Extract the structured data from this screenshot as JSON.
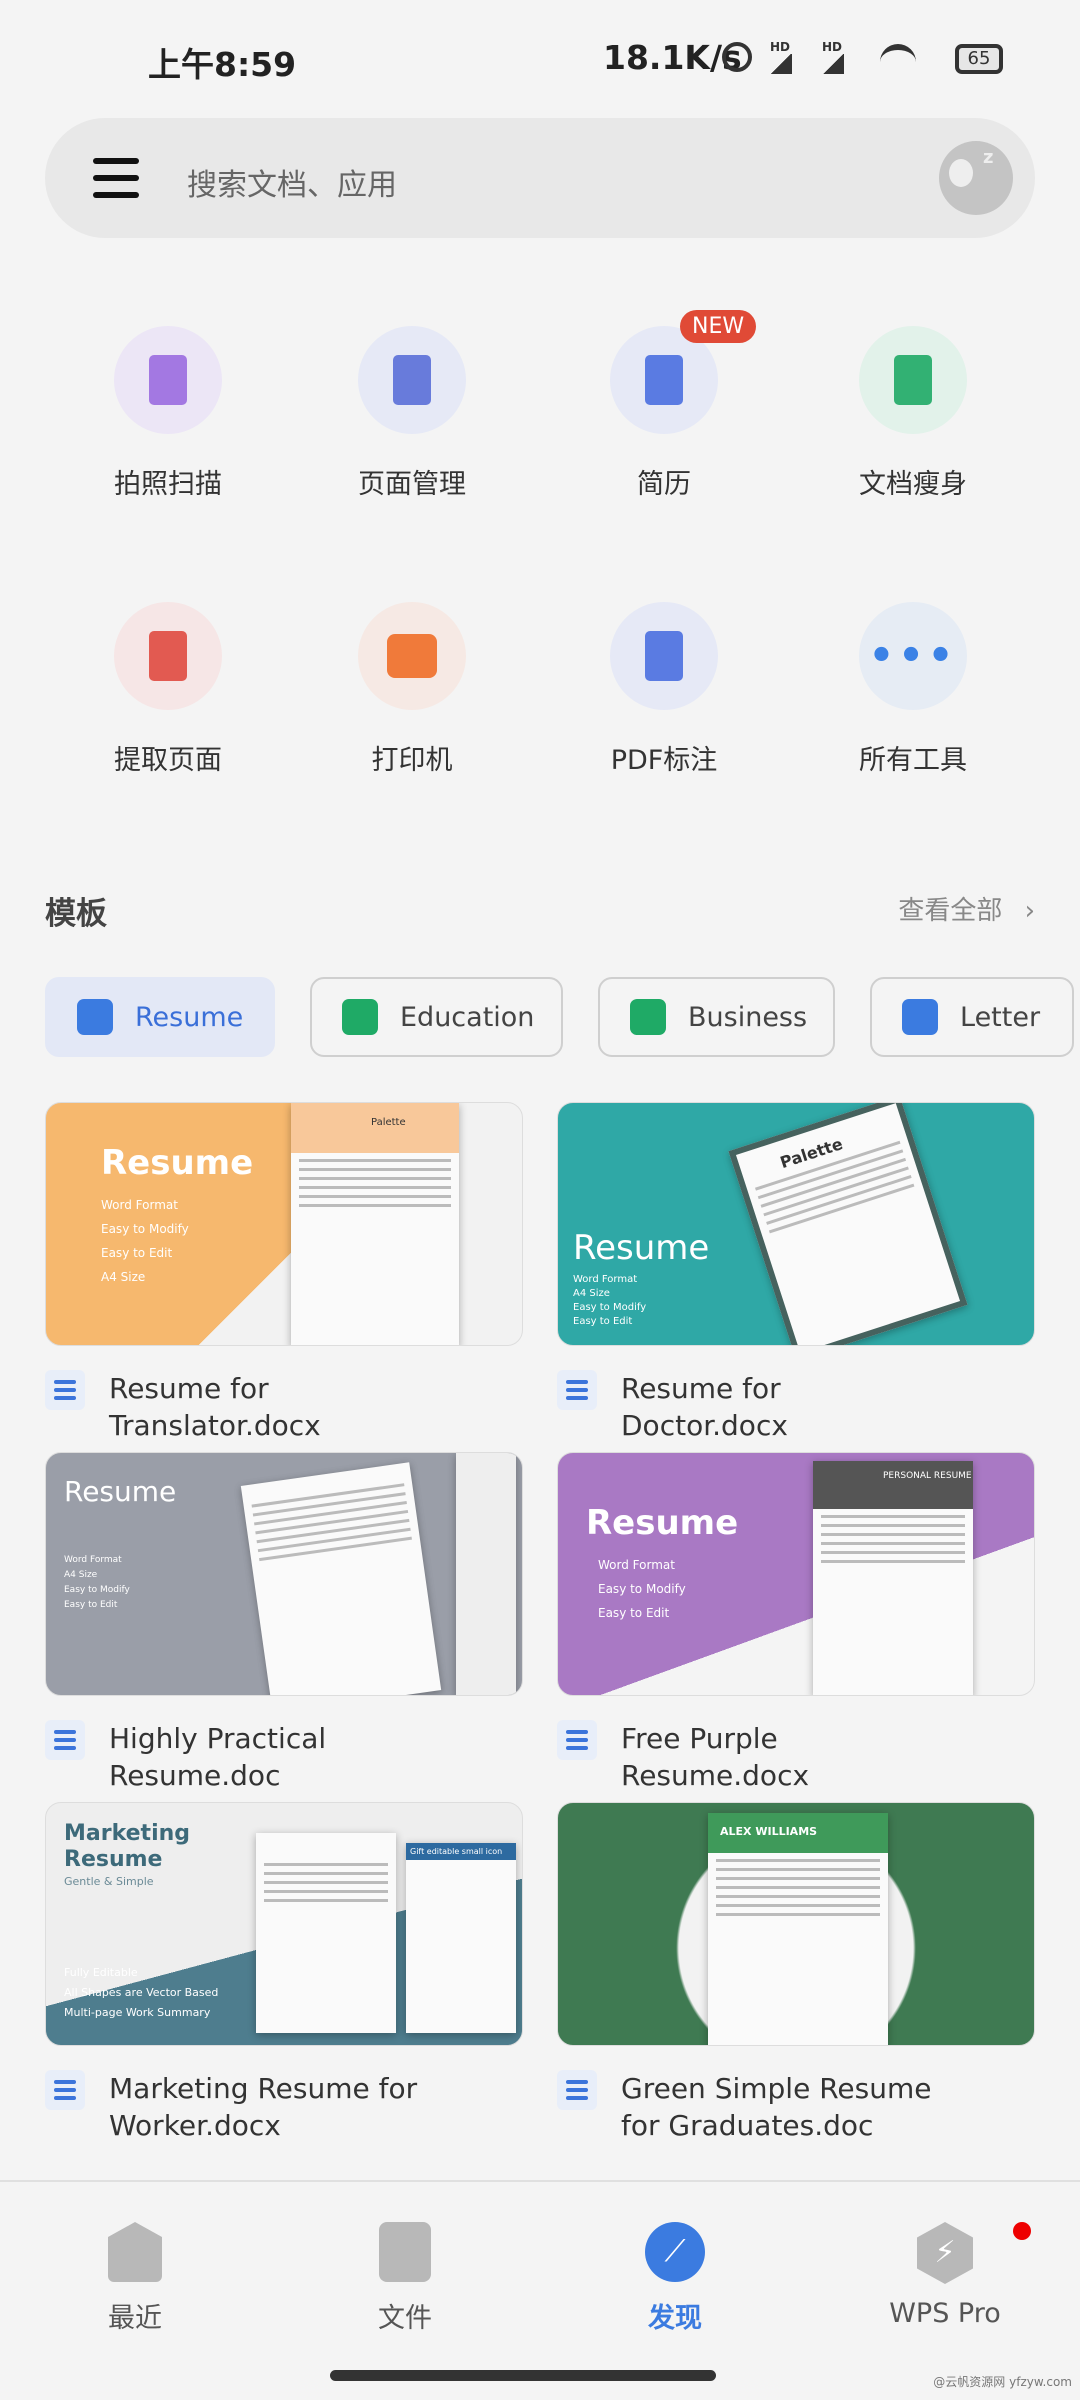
{
  "status_bar": {
    "time": "上午8:59",
    "speed": "18.1K/s",
    "hd1": "HD",
    "hd2": "HD",
    "battery": "65"
  },
  "search": {
    "placeholder": "搜索文档、应用",
    "menu_icon": "hamburger-icon",
    "avatar_icon": "sleeping-avatar-icon"
  },
  "tools": [
    {
      "label": "拍照扫描",
      "icon": "scan-icon",
      "color": "#9b6be0",
      "bg": "#ece6f6"
    },
    {
      "label": "页面管理",
      "icon": "page-manage-icon",
      "color": "#5a6fd8",
      "bg": "#e6e9f6"
    },
    {
      "label": "简历",
      "icon": "resume-icon",
      "color": "#4a6fe0",
      "bg": "#e6e9f6",
      "badge": "NEW"
    },
    {
      "label": "文档瘦身",
      "icon": "doc-slim-icon",
      "color": "#1faa66",
      "bg": "#e2f2ea"
    },
    {
      "label": "提取页面",
      "icon": "extract-page-icon",
      "color": "#e04a40",
      "bg": "#f6e6e6"
    },
    {
      "label": "打印机",
      "icon": "printer-icon",
      "color": "#f07a3a",
      "bg": "#f6e9e4"
    },
    {
      "label": "PDF标注",
      "icon": "pdf-annotate-icon",
      "color": "#4a6fe0",
      "bg": "#e6e9f6"
    },
    {
      "label": "所有工具",
      "icon": "more-icon",
      "color": "#3b82e6",
      "bg": "#e6ecf4"
    }
  ],
  "templates": {
    "title": "模板",
    "see_all": "查看全部",
    "chips": [
      {
        "label": "Resume",
        "color": "#3b7be0",
        "active": true
      },
      {
        "label": "Education",
        "color": "#1faa66"
      },
      {
        "label": "Business",
        "color": "#1faa66"
      },
      {
        "label": "Letter",
        "color": "#3b7be0"
      }
    ],
    "cards": [
      {
        "title": "Resume for Translator.docx",
        "thumb": {
          "heading": "Resume",
          "bullets": [
            "Word Format",
            "Easy to Modify",
            "Easy to Edit",
            "A4 Size"
          ],
          "name": "Palette"
        }
      },
      {
        "title": "Resume for Doctor.docx",
        "thumb": {
          "heading": "Resume",
          "bullets": [
            "Word Format",
            "A4 Size",
            "Easy to Modify",
            "Easy to Edit"
          ],
          "name": "Palette"
        }
      },
      {
        "title": "Highly Practical Resume.doc",
        "thumb": {
          "heading": "Resume",
          "bullets": [
            "Word Format",
            "A4 Size",
            "Easy to Modify",
            "Easy to Edit"
          ]
        }
      },
      {
        "title": "Free Purple Resume.docx",
        "thumb": {
          "heading": "Resume",
          "bullets": [
            "Word Format",
            "Easy to Modify",
            "Easy to Edit"
          ],
          "name": "PERSONAL RESUME"
        }
      },
      {
        "title": "Marketing Resume for Worker.docx",
        "thumb": {
          "heading": "Marketing Resume",
          "sub": "Gentle & Simple",
          "bullets": [
            "Fully Editable",
            "All Shapes are Vector Based",
            "Multi-page Work Summary"
          ],
          "name": "Gift editable small icon"
        }
      },
      {
        "title": "Green Simple Resume for Graduates.doc",
        "thumb": {
          "name": "ALEX WILLIAMS"
        }
      }
    ]
  },
  "nav": [
    {
      "label": "最近",
      "icon": "recent-icon"
    },
    {
      "label": "文件",
      "icon": "files-icon"
    },
    {
      "label": "发现",
      "icon": "compass-icon",
      "active": true,
      "color": "#3b7be0"
    },
    {
      "label": "WPS Pro",
      "icon": "wps-pro-icon",
      "dot": true
    }
  ],
  "watermark": "@云帆资源网 yfzyw.com"
}
